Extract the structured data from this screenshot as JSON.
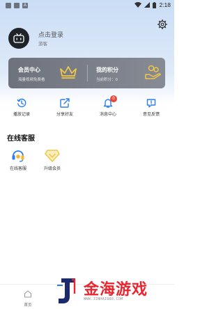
{
  "status_bar": {
    "time": "2:18",
    "icons": [
      "gallery-icon",
      "clipboard-icon",
      "text-a-icon",
      "wifi-icon",
      "signal-icon",
      "battery-icon"
    ]
  },
  "profile": {
    "login_prompt": "点击登录",
    "guest_label": "游客"
  },
  "vip_card": {
    "title": "会员中心",
    "subtitle": "海量视频免费看"
  },
  "points_card": {
    "title": "我的积分",
    "subtitle": "当前积分：0"
  },
  "quick_actions": [
    {
      "label": "播放记录",
      "icon": "history-icon"
    },
    {
      "label": "分享好友",
      "icon": "share-icon"
    },
    {
      "label": "消息中心",
      "icon": "bell-icon",
      "badge": "0"
    },
    {
      "label": "意见反馈",
      "icon": "feedback-icon"
    }
  ],
  "service_section": {
    "title": "在线客服",
    "items": [
      {
        "label": "在线客服",
        "icon": "headset-icon"
      },
      {
        "label": "升级会员",
        "icon": "diamond-icon"
      }
    ]
  },
  "bottom_nav": {
    "visible_label": "首页"
  },
  "watermark": {
    "text": "金海游戏",
    "url": "WWW.JINHAI888.COM"
  },
  "colors": {
    "accent_blue": "#2d7df0",
    "badge_red": "#e64a3b",
    "vip_gold": "#f0c64a",
    "card_gray": "#777c85"
  }
}
